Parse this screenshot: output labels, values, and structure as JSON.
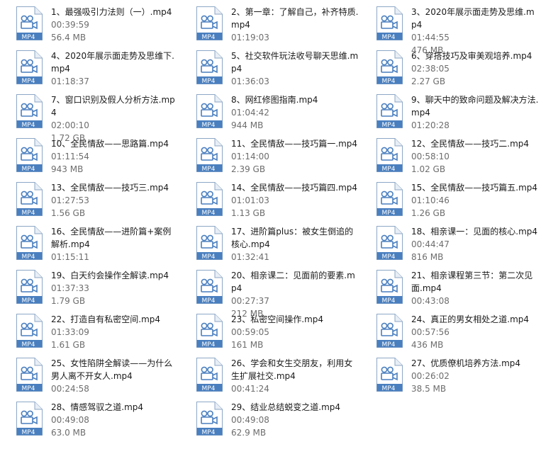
{
  "icon_colors": {
    "border": "#8ca7c6",
    "fill": "#ffffff",
    "accent": "#4a7fbf",
    "band": "#4a7fbf"
  },
  "file_type_badge": "MP4",
  "files": [
    {
      "name": "1、最强吸引力法则（一）.mp4",
      "duration": "00:39:59",
      "size": "56.4 MB"
    },
    {
      "name": "2、第一章：了解自己，补齐特质.mp4",
      "duration": "01:19:03",
      "size": ""
    },
    {
      "name": "3、2020年展示面走势及思维.mp4",
      "duration": "01:44:55",
      "size": "476 MB"
    },
    {
      "name": "4、2020年展示面走势及思维下.mp4",
      "duration": "01:18:37",
      "size": ""
    },
    {
      "name": "5、社交软件玩法收号聊天思维.mp4",
      "duration": "01:36:03",
      "size": ""
    },
    {
      "name": "6、穿搭技巧及审美观培养.mp4",
      "duration": "02:38:05",
      "size": "2.27 GB"
    },
    {
      "name": "7、窗口识别及假人分析方法.mp4",
      "duration": "02:00:10",
      "size": "1.72 GB"
    },
    {
      "name": "8、网红修图指南.mp4",
      "duration": "01:04:42",
      "size": "944 MB"
    },
    {
      "name": "9、聊天中的致命问题及解决方法.mp4",
      "duration": "01:20:28",
      "size": ""
    },
    {
      "name": "10、全民情敌——思路篇.mp4",
      "duration": "01:11:54",
      "size": "943 MB"
    },
    {
      "name": "11、全民情敌——技巧篇一.mp4",
      "duration": "01:14:00",
      "size": "2.39 GB"
    },
    {
      "name": "12、全民情敌——技巧二.mp4",
      "duration": "00:58:10",
      "size": "1.02 GB"
    },
    {
      "name": "13、全民情敌——技巧三.mp4",
      "duration": "01:27:53",
      "size": "1.56 GB"
    },
    {
      "name": "14、全民情敌——技巧篇四.mp4",
      "duration": "01:01:03",
      "size": "1.13 GB"
    },
    {
      "name": "15、全民情敌——技巧篇五.mp4",
      "duration": "01:10:46",
      "size": "1.26 GB"
    },
    {
      "name": "16、全民情敌——进阶篇+案例解析.mp4",
      "duration": "01:15:11",
      "size": ""
    },
    {
      "name": "17、进阶篇plus：被女生倒追的核心.mp4",
      "duration": "01:32:41",
      "size": ""
    },
    {
      "name": "18、相亲课一：见面的核心.mp4",
      "duration": "00:44:47",
      "size": "816 MB"
    },
    {
      "name": "19、白天约会操作全解读.mp4",
      "duration": "01:37:33",
      "size": "1.79 GB"
    },
    {
      "name": "20、相亲课二：见面前的要素.mp4",
      "duration": "00:27:37",
      "size": "212 MB"
    },
    {
      "name": "21、相亲课程第三节：第二次见面.mp4",
      "duration": "00:43:08",
      "size": ""
    },
    {
      "name": "22、打造自有私密空间.mp4",
      "duration": "01:33:09",
      "size": "1.61 GB"
    },
    {
      "name": "23、私密空间操作.mp4",
      "duration": "00:59:05",
      "size": "161 MB"
    },
    {
      "name": "24、真正的男女相处之道.mp4",
      "duration": "00:57:56",
      "size": "436 MB"
    },
    {
      "name": "25、女性陷阱全解读——为什么男人离不开女人.mp4",
      "duration": "00:24:58",
      "size": ""
    },
    {
      "name": "26、学会和女生交朋友，利用女生扩展社交.mp4",
      "duration": "00:41:24",
      "size": ""
    },
    {
      "name": "27、优质僚机培养方法.mp4",
      "duration": "00:26:02",
      "size": "38.5 MB"
    },
    {
      "name": "28、情感驾驭之道.mp4",
      "duration": "00:49:08",
      "size": "63.0 MB"
    },
    {
      "name": "29、结业总结蜕变之道.mp4",
      "duration": "00:49:08",
      "size": "62.9 MB"
    }
  ]
}
